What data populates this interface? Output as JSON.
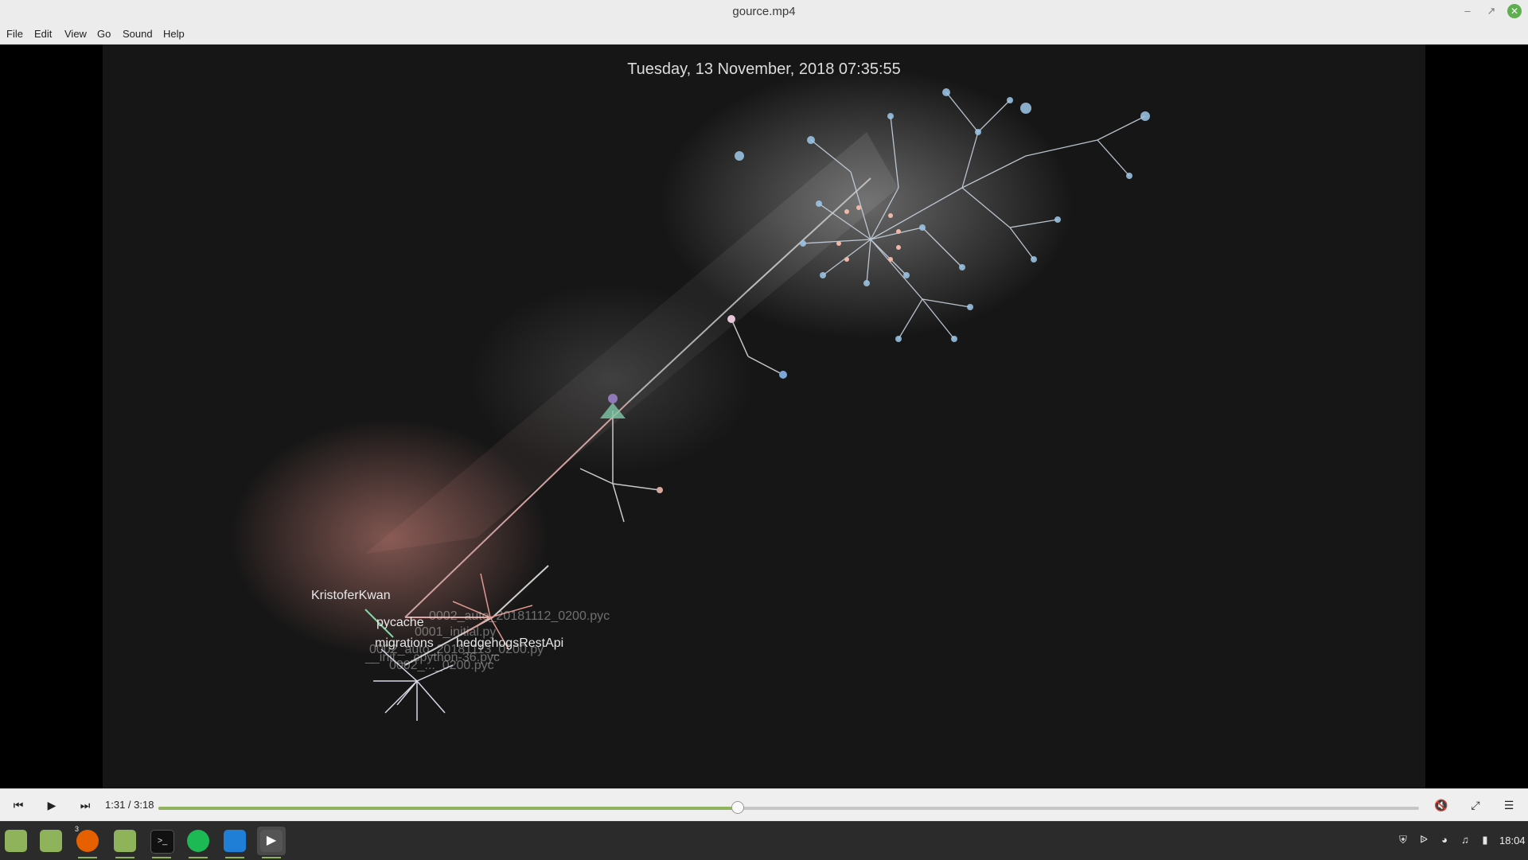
{
  "window": {
    "title": "gource.mp4"
  },
  "menu": {
    "items": [
      "File",
      "Edit",
      "View",
      "Go",
      "Sound",
      "Help"
    ]
  },
  "video": {
    "datestamp": "Tuesday, 13 November, 2018 07:35:55",
    "labels": {
      "user": "KristoferKwan",
      "pycache": "pycache",
      "migrations": "migrations",
      "api": "hedgehogsRestApi",
      "file1": "0002_auto_20181112_0200.pyc",
      "file2": "__init__.cpython-36.pyc",
      "file3": "0001_initial.py",
      "file4": "0002_auto_20181113_0200.py",
      "file5": "0002_..._0200.pyc"
    }
  },
  "controls": {
    "time_current": "1:31",
    "time_total": "3:18",
    "time_display": "1:31 / 3:18",
    "progress_fraction": 0.4596
  },
  "taskbar": {
    "apps": [
      {
        "name": "menu-icon",
        "color": "#8fb35a"
      },
      {
        "name": "show-desktop-icon",
        "color": "#8fb35a"
      },
      {
        "name": "firefox-icon",
        "color": "#e66000"
      },
      {
        "name": "files-icon",
        "color": "#8fb35a"
      },
      {
        "name": "terminal-icon",
        "color": "#111111"
      },
      {
        "name": "spotify-icon",
        "color": "#1db954"
      },
      {
        "name": "vscode-icon",
        "color": "#1f7ed6"
      },
      {
        "name": "media-player-icon",
        "color": "#555555"
      }
    ],
    "firefox_badge": "3",
    "clock": "18:04"
  }
}
